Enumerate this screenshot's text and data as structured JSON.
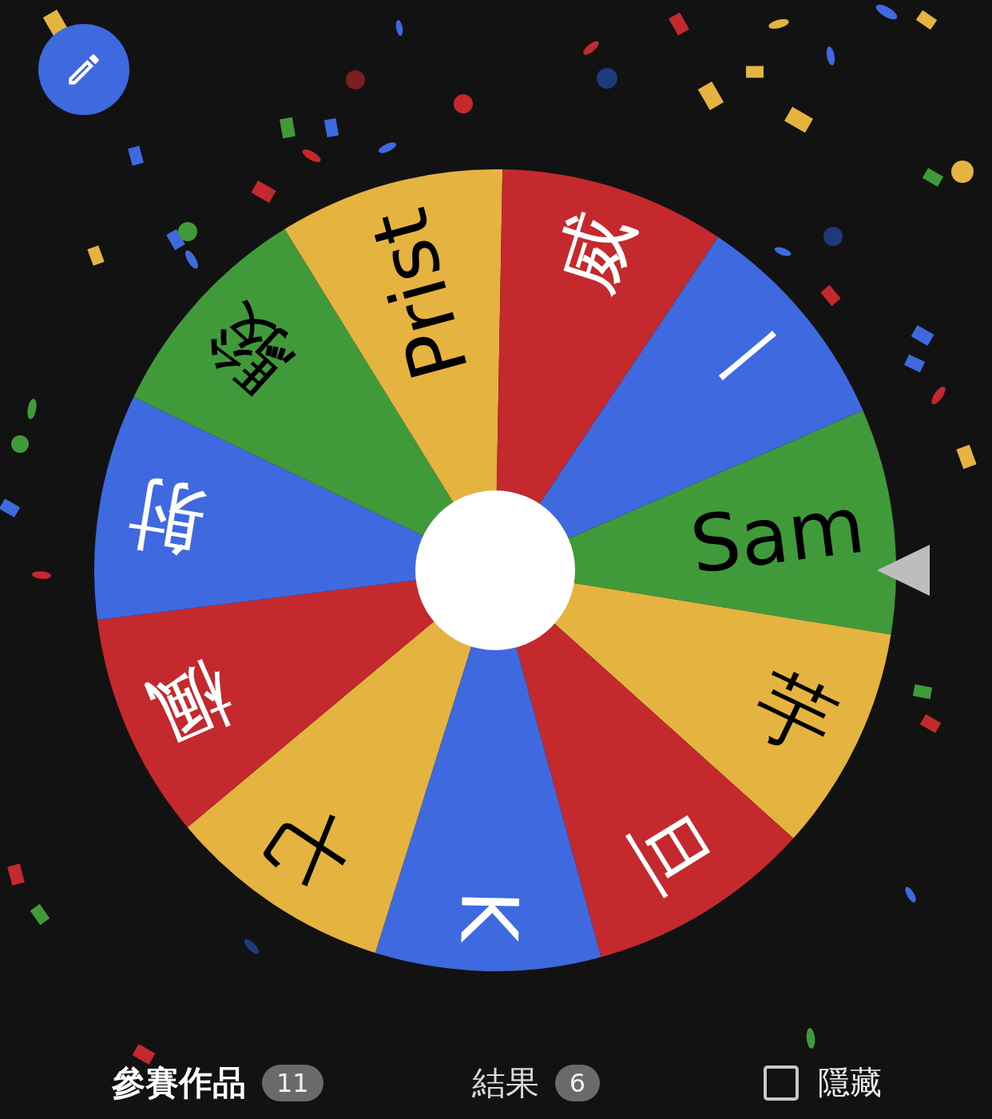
{
  "wheel": {
    "segments": [
      {
        "label": "Sam",
        "color": "#409a3a"
      },
      {
        "label": "芋",
        "color": "#e5b33f"
      },
      {
        "label": "旦",
        "color": "#c4292e"
      },
      {
        "label": "K",
        "color": "#3f69de"
      },
      {
        "label": "七",
        "color": "#e5b33f"
      },
      {
        "label": "楓",
        "color": "#c4292e"
      },
      {
        "label": "射",
        "color": "#3f69de"
      },
      {
        "label": "駿",
        "color": "#409a3a"
      },
      {
        "label": "Prist",
        "color": "#e5b33f"
      },
      {
        "label": "威",
        "color": "#c4292e"
      },
      {
        "label": "一",
        "color": "#3f69de"
      }
    ]
  },
  "tabs": [
    {
      "label": "參賽作品",
      "count": "11",
      "selected": true
    },
    {
      "label": "結果",
      "count": "6",
      "selected": false
    }
  ],
  "hide_toggle": {
    "label": "隱藏",
    "checked": false
  }
}
